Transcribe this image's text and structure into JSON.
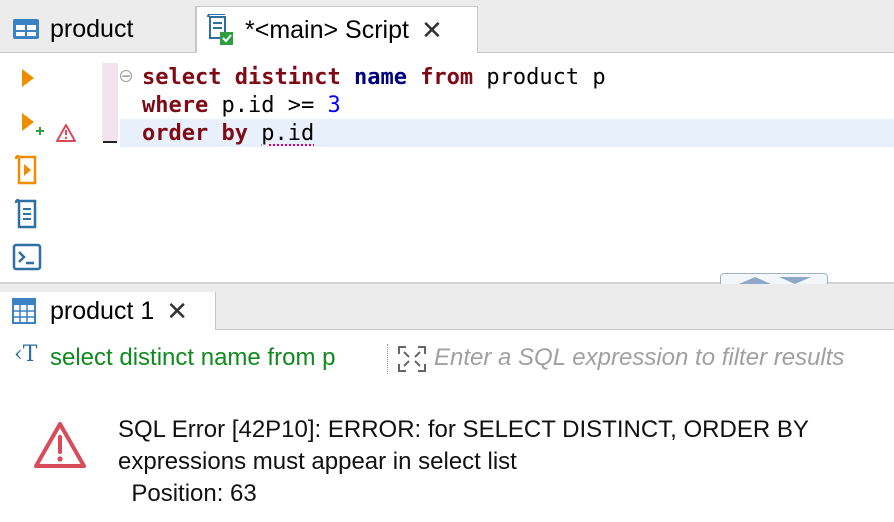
{
  "editor_tabs": [
    {
      "label": "product",
      "icon": "table-grid-icon",
      "active": false
    },
    {
      "label": "*<main> Script",
      "icon": "sql-script-icon",
      "active": true
    }
  ],
  "editor": {
    "lines": [
      "select distinct name from product p",
      "where p.id >= 3",
      "order by p.id"
    ]
  },
  "result_tab": {
    "label": "product 1",
    "icon": "table-grid-icon"
  },
  "filter": {
    "query_text": "select distinct name from p",
    "placeholder": "Enter a SQL expression to filter results"
  },
  "error": {
    "lines": [
      "SQL Error [42P10]: ERROR: for SELECT DISTINCT, ORDER BY",
      "expressions must appear in select list",
      "  Position: 63"
    ]
  },
  "colors": {
    "keyword": "#7f0a16",
    "keyword_blue": "#00007f",
    "number": "#0000ff",
    "filter_query": "#0f8a1d",
    "error_icon": "#d94a5a",
    "toolbar_orange": "#f08c00",
    "toolbar_blue": "#2f6fa3"
  }
}
